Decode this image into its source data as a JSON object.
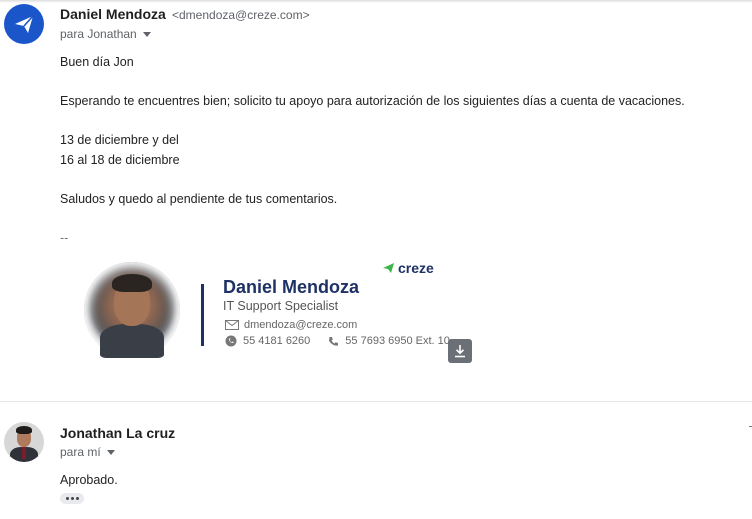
{
  "message1": {
    "sender_name": "Daniel Mendoza",
    "sender_email": "<dmendoza@creze.com>",
    "recipient_label": "para Jonathan",
    "body": {
      "greeting": "Buen día Jon",
      "request": "Esperando te encuentres bien; solicito tu apoyo para autorización de los siguientes días a cuenta de vacaciones.",
      "date_line_1": "13 de diciembre y del",
      "date_line_2": "16 al 18 de diciembre",
      "closing": "Saludos y quedo al pendiente de tus comentarios.",
      "sig_separator": "--"
    },
    "signature": {
      "logo": "creze",
      "name": "Daniel Mendoza",
      "title": "IT Support Specialist",
      "email": "dmendoza@creze.com",
      "phone_1": "55 4181 6260",
      "phone_2": "55 7693 6950 Ext. 10"
    }
  },
  "message2": {
    "sender_name": "Jonathan La cruz",
    "recipient_label": "para mí",
    "body": "Aprobado."
  },
  "colors": {
    "brand_navy": "#1f3266",
    "brand_green": "#3bb54a",
    "avatar_blue": "#1a56c9"
  },
  "icons": {
    "sender_avatar": "paper-plane-icon",
    "mail": "mail-icon",
    "whatsapp": "whatsapp-icon",
    "phone": "phone-icon",
    "download": "download-icon",
    "more": "ellipsis-icon"
  }
}
